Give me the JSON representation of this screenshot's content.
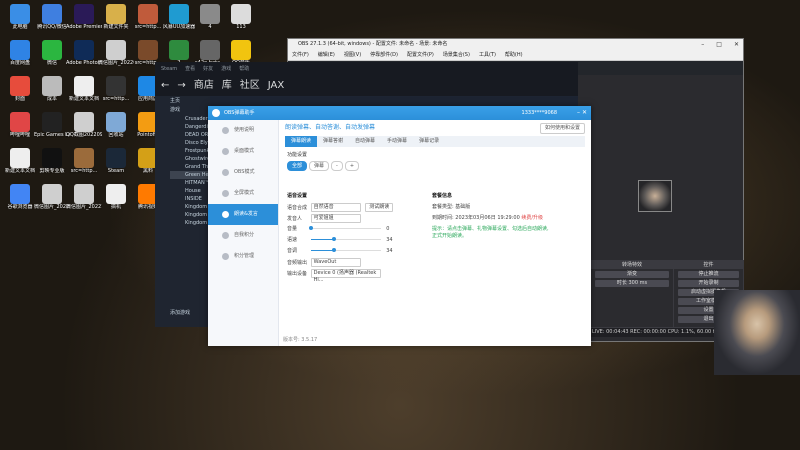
{
  "desktop_icons": [
    {
      "label": "此电脑",
      "color": "#3a8ee6"
    },
    {
      "label": "腾讯QQ/微信",
      "color": "#3f7fe0"
    },
    {
      "label": "Adobe Premiere",
      "color": "#2a1a57"
    },
    {
      "label": "新建文件夹",
      "color": "#d8b04a"
    },
    {
      "label": "src=http...",
      "color": "#c05b3b"
    },
    {
      "label": "风暴UU加速器",
      "color": "#1f9bd1"
    },
    {
      "label": "4",
      "color": "#8a8a8a"
    },
    {
      "label": "113",
      "color": "#dcdcdc"
    },
    {
      "label": "百度网盘",
      "color": "#2f83e5"
    },
    {
      "label": "微信",
      "color": "#2bb640"
    },
    {
      "label": "Adobe Photoshop",
      "color": "#0f2b57"
    },
    {
      "label": "微信图片_2022081...",
      "color": "#cfcfcf"
    },
    {
      "label": "src=http...",
      "color": "#7a4a2a"
    },
    {
      "label": "2",
      "color": "#2e8b3e"
    },
    {
      "label": "s42e-beta...",
      "color": "#666"
    },
    {
      "label": "QQ音乐",
      "color": "#f1c40f"
    },
    {
      "label": "封面",
      "color": "#e74c3c"
    },
    {
      "label": "成本",
      "color": "#bbb"
    },
    {
      "label": "新建文本文档",
      "color": "#eee"
    },
    {
      "label": "src=http...",
      "color": "#333"
    },
    {
      "label": "应用商店",
      "color": "#1e88e5"
    },
    {
      "label": "Rockstar Games...",
      "color": "#f5b400"
    },
    {
      "label": "射手",
      "color": "#c0392b"
    },
    {
      "label": "新建文本文档",
      "color": "#eee"
    },
    {
      "label": "哔哩哔哩",
      "color": "#e04646"
    },
    {
      "label": "Epic Games Launcher",
      "color": "#222"
    },
    {
      "label": "QQ截图2022090...",
      "color": "#cfcfcf"
    },
    {
      "label": "回收站",
      "color": "#7fa9d6"
    },
    {
      "label": "Pointofix",
      "color": "#f39c12"
    },
    {
      "label": "快剪辑",
      "color": "#e74c3c"
    },
    {
      "label": "头像",
      "color": "#444"
    },
    {
      "label": "迅雷",
      "color": "#3f79d6"
    },
    {
      "label": "新建文本文档",
      "color": "#eee"
    },
    {
      "label": "剪映专业版",
      "color": "#111"
    },
    {
      "label": "src=http...",
      "color": "#9b6b3b"
    },
    {
      "label": "Steam",
      "color": "#1b2838"
    },
    {
      "label": "黑料",
      "color": "#d4a017"
    },
    {
      "label": "迅雷影音",
      "color": "#2d7fd6"
    },
    {
      "label": "应用程序",
      "color": "#eee"
    },
    {
      "label": "OBS Studio",
      "color": "#302e31"
    },
    {
      "label": "谷歌浏览器",
      "color": "#4285f4"
    },
    {
      "label": "微信图片_2022081...",
      "color": "#cfcfcf"
    },
    {
      "label": "微信图片_2022101...",
      "color": "#cfcfcf"
    },
    {
      "label": "搞机",
      "color": "#eee"
    },
    {
      "label": "腾讯视频",
      "color": "#ff7a00"
    },
    {
      "label": "360安全浏览器",
      "color": "#3ba54a"
    },
    {
      "label": "0c12e916...",
      "color": "#cfcfcf"
    },
    {
      "label": "QQ图片2022127...",
      "color": "#cfcfcf"
    }
  ],
  "obs": {
    "title": "OBS 27.1.3 (64-bit, windows) - 配置文件: 未命名 - 场景: 未命名",
    "menu": [
      "文件(F)",
      "编辑(E)",
      "视图(V)",
      "停靠部件(D)",
      "配置文件(P)",
      "场景集合(S)",
      "工具(T)",
      "帮助(H)"
    ],
    "controls_dock_title": "控件",
    "controls": [
      "停止推流",
      "开始录制",
      "启动虚拟摄像机",
      "工作室模式",
      "设置",
      "退出"
    ],
    "mixer_title": "转场特效",
    "mixer_fields": [
      "渐变",
      "时长 300 ms"
    ],
    "status": "LIVE: 00:04:43  REC: 00:00:00  CPU: 1.1%, 60.00 fps"
  },
  "steam": {
    "top": [
      "Steam",
      "查看",
      "好友",
      "游戏",
      "帮助"
    ],
    "nav": [
      "商店",
      "库",
      "社区",
      "JAX"
    ],
    "home_label": "主页",
    "games_label": "游戏",
    "games": [
      "Crusader Kings",
      "Dangerdisp...",
      "DEAD OR AL...",
      "Disco Elysiu...",
      "Frostpunk",
      "Ghostwire: T...",
      "Grand Theft...",
      "Green Hell",
      "HITMAN™ 2",
      "House",
      "INSIDE",
      "Kingdom Ru...",
      "Kingdom Ru...",
      "Kingdom Ru..."
    ],
    "add_game": "添加游戏"
  },
  "dialog": {
    "title": "OBS弹幕助手",
    "account": "1333****9068",
    "sidebar": [
      "使用说明",
      "桌面模式",
      "OBS模式",
      "全屏模式",
      "朗读&发言",
      "自我积分",
      "积分管理"
    ],
    "active_sidebar_index": 4,
    "banner": "朗读弹幕、自动答谢、自动发弹幕",
    "help_button": "如何使用和设置",
    "tabs": [
      "弹幕朗读",
      "弹幕答谢",
      "自动弹幕",
      "手动弹幕",
      "弹幕记录"
    ],
    "active_tab_index": 0,
    "section_title": "功能设置",
    "filter_pills": [
      "全部",
      "弹幕",
      "-",
      "+"
    ],
    "voice_title": "语音设置",
    "voice_engine_label": "语音合成",
    "voice_engine_value": "自然语音",
    "voice_engine_btn": "测试朗读",
    "voice_person_label": "发音人",
    "voice_person_value": "可爱姐姐",
    "volume_label": "音量",
    "volume_value": "0",
    "volume_pct": 0,
    "speed_label": "语速",
    "speed_value": "34",
    "speed_pct": 34,
    "pitch_label": "音调",
    "pitch_value": "34",
    "pitch_pct": 34,
    "output_label": "音频输出",
    "output_value": "WaveOut",
    "device_label": "输出设备",
    "device_value": "Device 0 (扬声器 (Realtek Hi...",
    "account_title": "套餐信息",
    "plan_label": "套餐类型:",
    "plan_value": "基础版",
    "expire_label": "到期时间:",
    "expire_value": "2023年03月06日 19:29:00",
    "renew": "续费/升级",
    "tip1": "提示：请点击弹幕、礼物弹幕设置、勾选后自动朗读,",
    "tip2": "正式开始朗读。",
    "version": "版本号: 3.5.17"
  }
}
